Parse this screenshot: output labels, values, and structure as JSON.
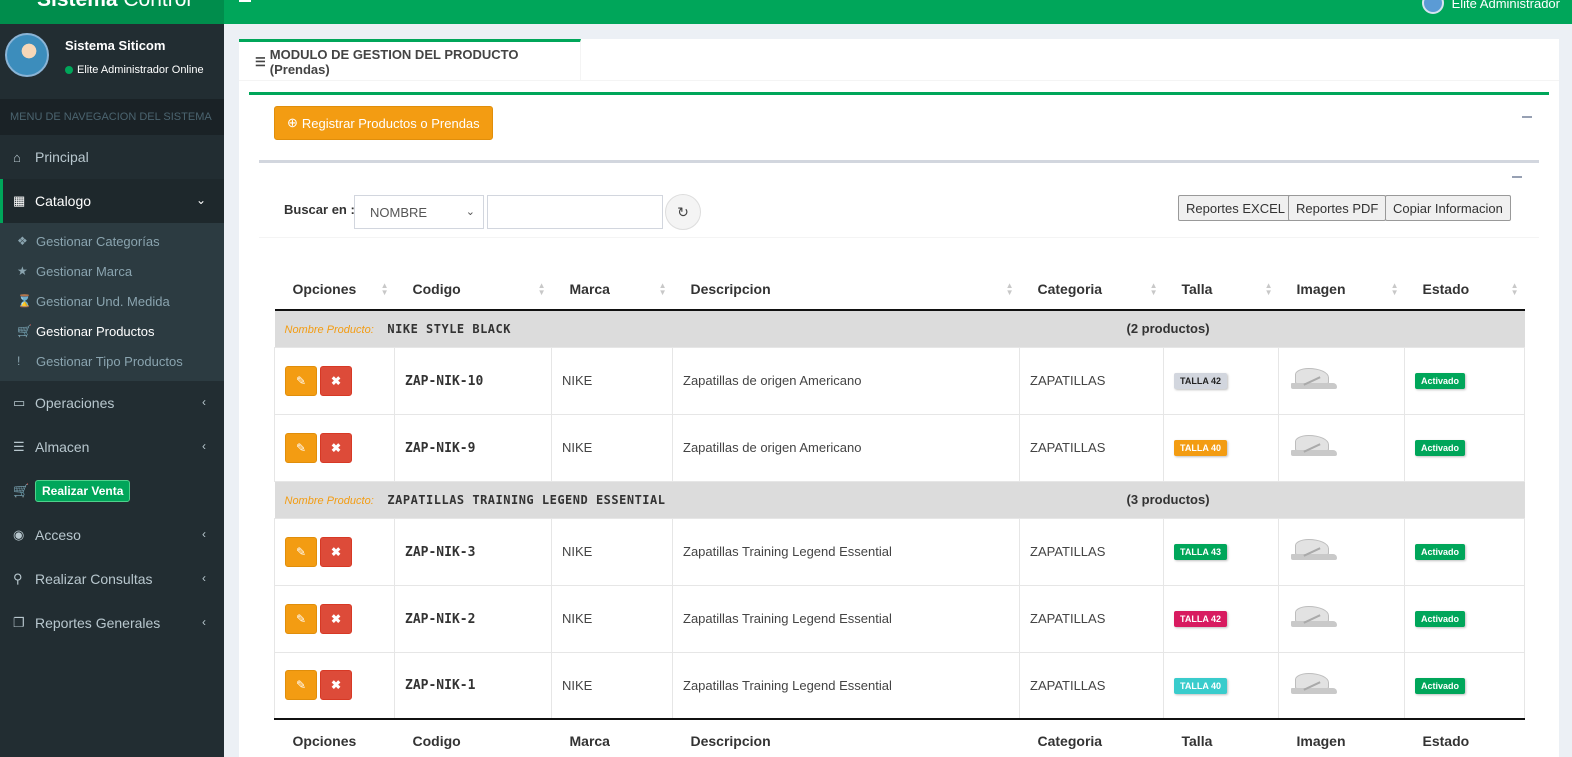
{
  "header": {
    "logo_bold": "Sistema",
    "logo_light": " Control",
    "user_name": "Elite Administrador"
  },
  "sidebar": {
    "user_name": "Sistema Siticom",
    "user_status": "Elite Administrador Online",
    "menu_header": "MENU DE NAVEGACION DEL SISTEMA",
    "items": [
      {
        "label": "Principal",
        "icon": "home-icon"
      },
      {
        "label": "Catalogo",
        "icon": "grid-icon"
      },
      {
        "label": "Operaciones",
        "icon": "laptop-icon"
      },
      {
        "label": "Almacen",
        "icon": "database-icon"
      },
      {
        "label": "Realizar Venta",
        "icon": "cart-icon"
      },
      {
        "label": "Acceso",
        "icon": "lock-icon"
      },
      {
        "label": "Realizar Consultas",
        "icon": "search-icon"
      },
      {
        "label": "Reportes Generales",
        "icon": "copy-icon"
      }
    ],
    "catalog_sub": [
      {
        "label": "Gestionar Categorías",
        "icon": "cube-icon"
      },
      {
        "label": "Gestionar Marca",
        "icon": "star-icon"
      },
      {
        "label": "Gestionar Und. Medida",
        "icon": "hourglass-icon"
      },
      {
        "label": "Gestionar Productos",
        "icon": "cart-icon"
      },
      {
        "label": "Gestionar Tipo Productos",
        "icon": "exclamation-icon"
      }
    ]
  },
  "tab": {
    "label": "MODULO DE GESTION DEL PRODUCTO (Prendas)"
  },
  "toolbar": {
    "register_label": "Registrar Productos o Prendas"
  },
  "search": {
    "label": "Buscar en :",
    "field_selected": "NOMBRE",
    "input_value": "",
    "export_excel": "Reportes EXCEL",
    "export_pdf": "Reportes PDF",
    "copy": "Copiar Informacion"
  },
  "table": {
    "columns": [
      "Opciones",
      "Codigo",
      "Marca",
      "Descripcion",
      "Categoria",
      "Talla",
      "Imagen",
      "Estado"
    ],
    "group_label": "Nombre Producto:",
    "groups": [
      {
        "name": "NIKE STYLE BLACK",
        "count": "(2 productos)",
        "rows": [
          {
            "code": "ZAP-NIK-10",
            "brand": "NIKE",
            "description": "Zapatillas de origen Americano",
            "category": "ZAPATILLAS",
            "size": "TALLA 42",
            "size_color": "#d2d6de",
            "size_text_color": "#222222",
            "status": "Activado"
          },
          {
            "code": "ZAP-NIK-9",
            "brand": "NIKE",
            "description": "Zapatillas de origen Americano",
            "category": "ZAPATILLAS",
            "size": "TALLA 40",
            "size_color": "#f39c12",
            "size_text_color": "#ffffff",
            "status": "Activado"
          }
        ]
      },
      {
        "name": "ZAPATILLAS TRAINING LEGEND ESSENTIAL",
        "count": "(3 productos)",
        "rows": [
          {
            "code": "ZAP-NIK-3",
            "brand": "NIKE",
            "description": "Zapatillas Training Legend Essential",
            "category": "ZAPATILLAS",
            "size": "TALLA 43",
            "size_color": "#00a65a",
            "size_text_color": "#ffffff",
            "status": "Activado"
          },
          {
            "code": "ZAP-NIK-2",
            "brand": "NIKE",
            "description": "Zapatillas Training Legend Essential",
            "category": "ZAPATILLAS",
            "size": "TALLA 42",
            "size_color": "#d81b60",
            "size_text_color": "#ffffff",
            "status": "Activado"
          },
          {
            "code": "ZAP-NIK-1",
            "brand": "NIKE",
            "description": "Zapatillas Training Legend Essential",
            "category": "ZAPATILLAS",
            "size": "TALLA 40",
            "size_color": "#39cccc",
            "size_text_color": "#ffffff",
            "status": "Activado"
          }
        ]
      }
    ]
  },
  "colors": {
    "primary": "#00a65a",
    "warning": "#f39c12",
    "danger": "#dd4b39",
    "sidebar_bg": "#222d32"
  }
}
